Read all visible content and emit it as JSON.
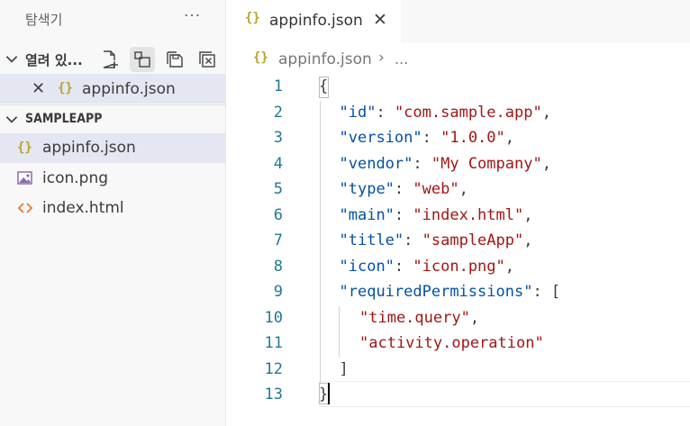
{
  "sidebar": {
    "title": "탐색기",
    "more": "···",
    "open_editors": {
      "label": "열려 있...",
      "files": [
        {
          "name": "appinfo.json",
          "icon": "json-braces-icon"
        }
      ]
    },
    "project": {
      "label": "SAMPLEAPP",
      "files": [
        {
          "name": "appinfo.json",
          "icon": "json-braces-icon"
        },
        {
          "name": "icon.png",
          "icon": "image-file-icon"
        },
        {
          "name": "index.html",
          "icon": "html-brackets-icon"
        }
      ]
    }
  },
  "editor": {
    "tab": {
      "label": "appinfo.json",
      "icon_text": "{}"
    },
    "breadcrumb": {
      "file": "appinfo.json",
      "separator": "›",
      "more": "..."
    },
    "line_numbers": [
      "1",
      "2",
      "3",
      "4",
      "5",
      "6",
      "7",
      "8",
      "9",
      "10",
      "11",
      "12",
      "13"
    ],
    "lines": [
      {
        "indent": 0,
        "tokens": [
          {
            "t": "{",
            "c": "p"
          }
        ]
      },
      {
        "indent": 1,
        "tokens": [
          {
            "t": "\"id\"",
            "c": "k"
          },
          {
            "t": ": ",
            "c": "p"
          },
          {
            "t": "\"com.sample.app\"",
            "c": "s"
          },
          {
            "t": ",",
            "c": "p"
          }
        ]
      },
      {
        "indent": 1,
        "tokens": [
          {
            "t": "\"version\"",
            "c": "k"
          },
          {
            "t": ": ",
            "c": "p"
          },
          {
            "t": "\"1.0.0\"",
            "c": "s"
          },
          {
            "t": ",",
            "c": "p"
          }
        ]
      },
      {
        "indent": 1,
        "tokens": [
          {
            "t": "\"vendor\"",
            "c": "k"
          },
          {
            "t": ": ",
            "c": "p"
          },
          {
            "t": "\"My Company\"",
            "c": "s"
          },
          {
            "t": ",",
            "c": "p"
          }
        ]
      },
      {
        "indent": 1,
        "tokens": [
          {
            "t": "\"type\"",
            "c": "k"
          },
          {
            "t": ": ",
            "c": "p"
          },
          {
            "t": "\"web\"",
            "c": "s"
          },
          {
            "t": ",",
            "c": "p"
          }
        ]
      },
      {
        "indent": 1,
        "tokens": [
          {
            "t": "\"main\"",
            "c": "k"
          },
          {
            "t": ": ",
            "c": "p"
          },
          {
            "t": "\"index.html\"",
            "c": "s"
          },
          {
            "t": ",",
            "c": "p"
          }
        ]
      },
      {
        "indent": 1,
        "tokens": [
          {
            "t": "\"title\"",
            "c": "k"
          },
          {
            "t": ": ",
            "c": "p"
          },
          {
            "t": "\"sampleApp\"",
            "c": "s"
          },
          {
            "t": ",",
            "c": "p"
          }
        ]
      },
      {
        "indent": 1,
        "tokens": [
          {
            "t": "\"icon\"",
            "c": "k"
          },
          {
            "t": ": ",
            "c": "p"
          },
          {
            "t": "\"icon.png\"",
            "c": "s"
          },
          {
            "t": ",",
            "c": "p"
          }
        ]
      },
      {
        "indent": 1,
        "tokens": [
          {
            "t": "\"requiredPermissions\"",
            "c": "k"
          },
          {
            "t": ": [",
            "c": "p"
          }
        ]
      },
      {
        "indent": 2,
        "tokens": [
          {
            "t": "\"time.query\"",
            "c": "s"
          },
          {
            "t": ",",
            "c": "p"
          }
        ]
      },
      {
        "indent": 2,
        "tokens": [
          {
            "t": "\"activity.operation\"",
            "c": "s"
          }
        ]
      },
      {
        "indent": 1,
        "tokens": [
          {
            "t": "]",
            "c": "p"
          }
        ]
      },
      {
        "indent": 0,
        "tokens": [
          {
            "t": "}",
            "c": "p"
          }
        ]
      }
    ]
  },
  "colors": {
    "key": "#0451a5",
    "string": "#a31515",
    "line_number": "#237893",
    "json_icon": "#b8a32a",
    "selection": "#e4e6f1"
  }
}
